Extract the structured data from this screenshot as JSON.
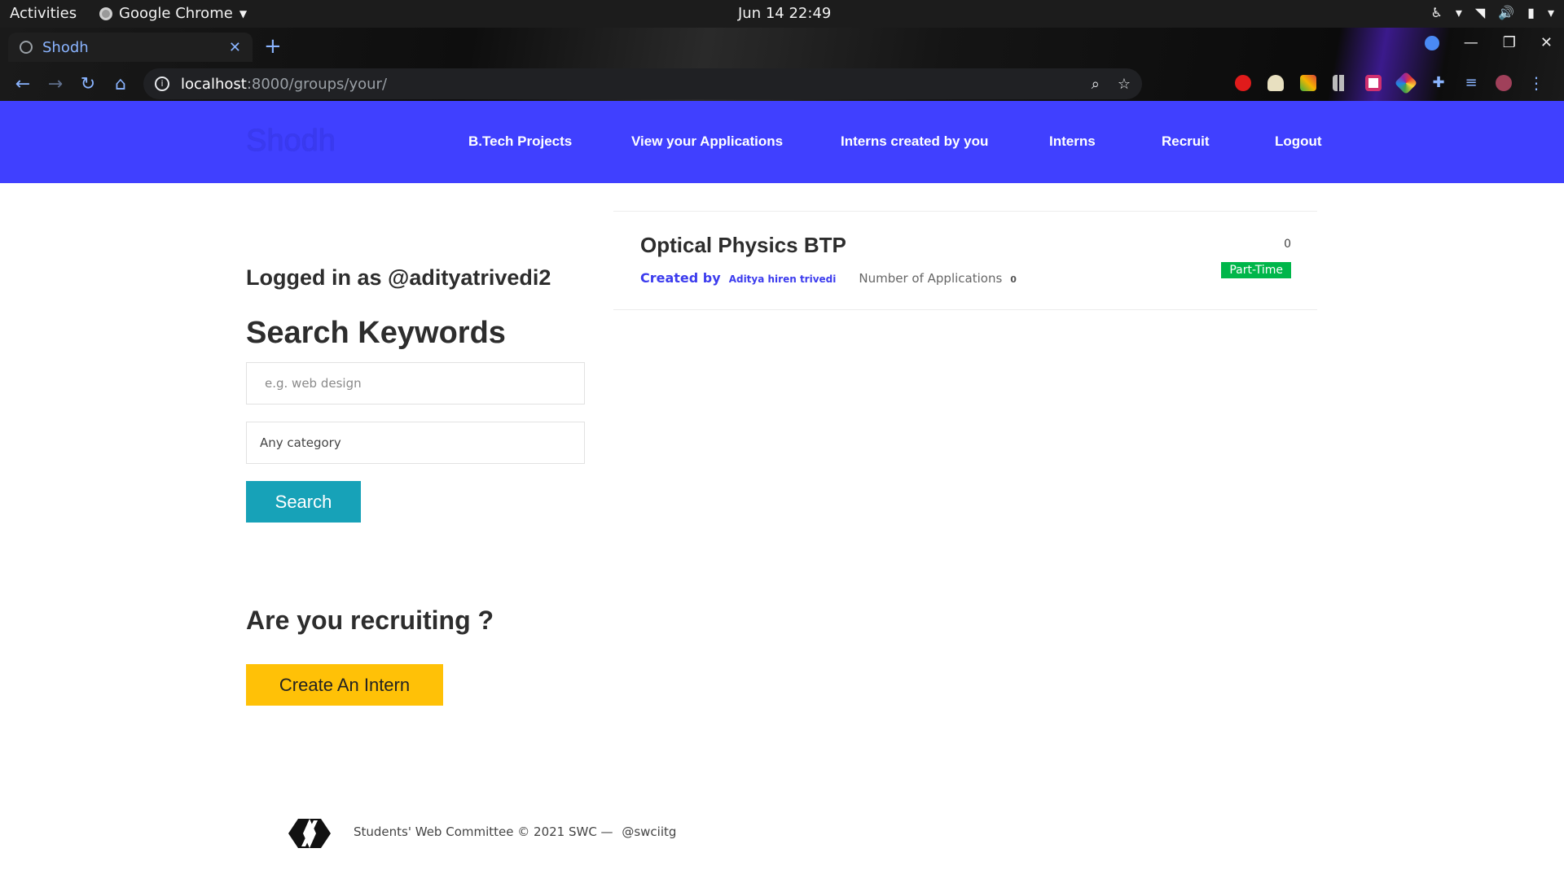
{
  "system": {
    "activities": "Activities",
    "app_name": "Google Chrome",
    "clock": "Jun 14  22:49"
  },
  "browser": {
    "tab_title": "Shodh",
    "url_host": "localhost",
    "url_path": ":8000/groups/your/"
  },
  "site": {
    "logo": "Shodh",
    "brand_color": "#4040ff",
    "nav": [
      "B.Tech Projects",
      "View your Applications",
      "Interns created by you",
      "Interns",
      "Recruit",
      "Logout"
    ]
  },
  "sidebar": {
    "logged_in": "Logged in as @adityatrivedi2",
    "search_title": "Search Keywords",
    "keyword_placeholder": "e.g. web design",
    "category_value": "Any category",
    "search_button": "Search",
    "recruit_title": "Are you recruiting ?",
    "create_button": "Create An Intern"
  },
  "jobs": [
    {
      "title": "Optical Physics BTP",
      "created_by_label": "Created by",
      "creator": "Aditya hiren trivedi",
      "applications_label": "Number of Applications",
      "applications_count": "0",
      "count": "0",
      "badge": "Part-Time",
      "badge_color": "#00b64a"
    }
  ],
  "footer": {
    "text": "Students' Web Committee © 2021 SWC —",
    "handle": "@swciitg"
  }
}
